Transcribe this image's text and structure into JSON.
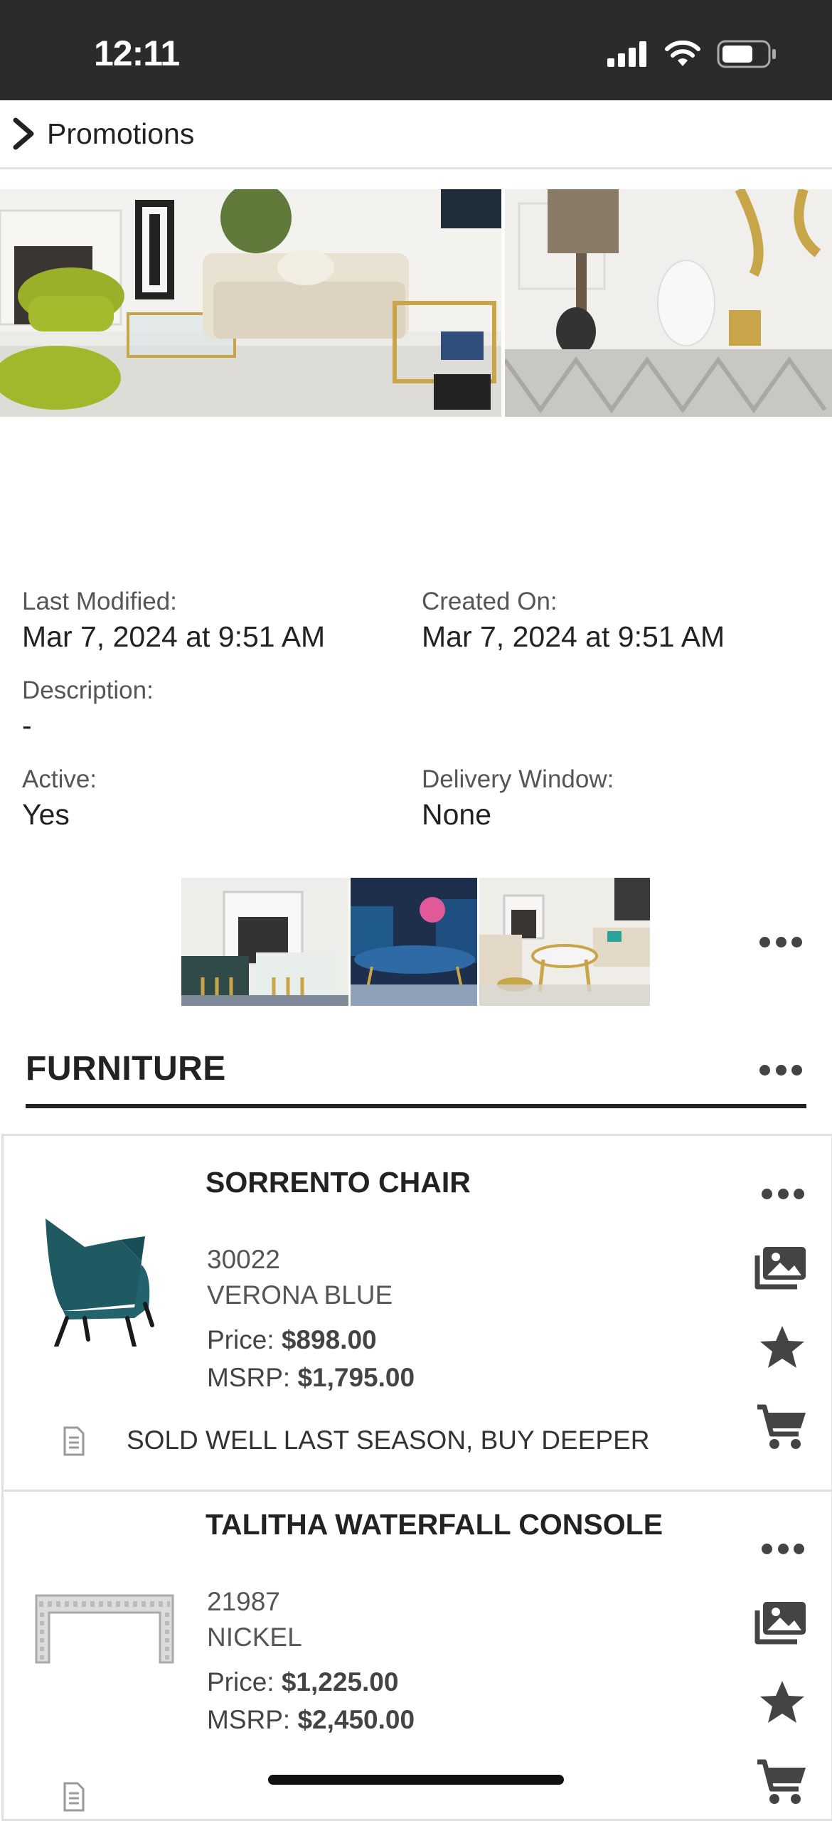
{
  "status_bar": {
    "time": "12:11"
  },
  "nav": {
    "title": "Promotions"
  },
  "details": {
    "last_modified_label": "Last Modified:",
    "last_modified_value": "Mar 7, 2024 at 9:51 AM",
    "created_on_label": "Created On:",
    "created_on_value": "Mar 7, 2024 at 9:51 AM",
    "description_label": "Description:",
    "description_value": "-",
    "active_label": "Active:",
    "active_value": "Yes",
    "delivery_window_label": "Delivery Window:",
    "delivery_window_value": "None"
  },
  "section": {
    "title": "FURNITURE"
  },
  "products": [
    {
      "name": "SORRENTO CHAIR",
      "sku": "30022",
      "color": "VERONA BLUE",
      "price_label": "Price:",
      "price": "$898.00",
      "msrp_label": "MSRP:",
      "msrp": "$1,795.00",
      "note": "SOLD WELL LAST SEASON, BUY DEEPER"
    },
    {
      "name": "TALITHA WATERFALL CONSOLE",
      "sku": "21987",
      "color": "NICKEL",
      "price_label": "Price:",
      "price": "$1,225.00",
      "msrp_label": "MSRP:",
      "msrp": "$2,450.00"
    }
  ],
  "colors": {
    "status_bar": "#2b2b2b",
    "text_dark": "#222222",
    "icon": "#444444"
  },
  "icons": [
    "chevron-right-icon",
    "more-icon",
    "gallery-icon",
    "star-icon",
    "cart-icon",
    "note-icon",
    "signal-icon",
    "wifi-icon",
    "battery-icon"
  ]
}
